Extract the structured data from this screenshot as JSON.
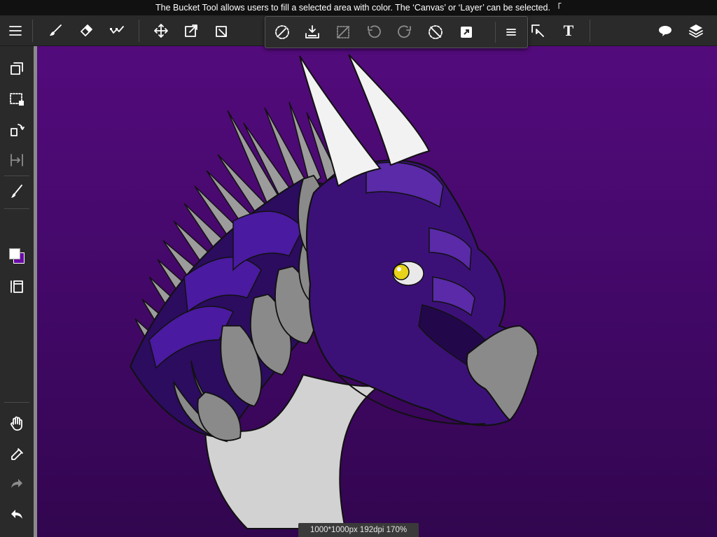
{
  "hint": {
    "text": "The Bucket Tool allows users to fill a selected area with color. The ‘Canvas’ or ‘Layer’ can be selected. 「"
  },
  "toolbar": {
    "tools": [
      "menu-icon",
      "brush-icon",
      "eraser-icon",
      "snap-icon",
      "move-icon",
      "transform-icon",
      "export-icon",
      "select-icon",
      "text-icon",
      "speech-bubble-icon",
      "layers-icon"
    ],
    "text_tool_glyph": "T"
  },
  "selection_toolbar": {
    "tools": [
      "deselect-icon",
      "fill-selection-icon",
      "clear-selection-icon",
      "rotate-left-icon",
      "rotate-right-icon",
      "cancel-transform-icon",
      "resize-icon",
      "more-menu-icon"
    ]
  },
  "sidebar": {
    "tools": [
      "copy-layer-icon",
      "selection-tool-icon",
      "transform-icon",
      "flip-icon",
      "brush-settings-icon",
      "color-swatch",
      "panel-icon",
      "hand-icon",
      "eyedropper-icon",
      "redo-icon",
      "undo-icon"
    ],
    "primary_color": "#ffffff",
    "secondary_color": "#6a0aa6"
  },
  "canvas": {
    "info": "1000*1000px 192dpi 170%",
    "background_top": "#530b7c",
    "background_bottom": "#32064f"
  },
  "colors": {
    "toolbar_bg": "#2a2a2a",
    "dragon_purple": "#3b1178",
    "dragon_dark": "#22084a",
    "horn": "#f2f2f2",
    "spike": "#9c9c9c",
    "scale_gray": "#8a8a8a",
    "throat": "#d2d2d2",
    "eye": "#e8d21a"
  }
}
